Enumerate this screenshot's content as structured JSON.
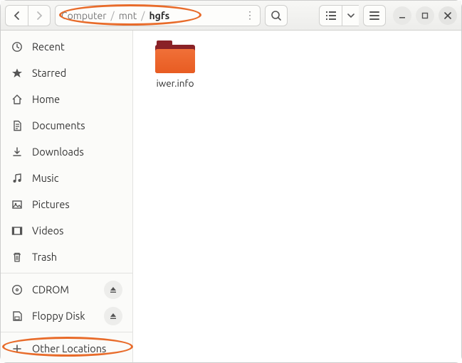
{
  "path": {
    "seg1": "Computer",
    "seg2": "mnt",
    "seg3": "hgfs"
  },
  "sidebar": {
    "places": [
      "Recent",
      "Starred",
      "Home",
      "Documents",
      "Downloads",
      "Music",
      "Pictures",
      "Videos",
      "Trash"
    ],
    "devices": [
      "CDROM",
      "Floppy Disk"
    ],
    "other": "Other Locations"
  },
  "content": {
    "items": [
      {
        "label": "iwer.info"
      }
    ]
  }
}
